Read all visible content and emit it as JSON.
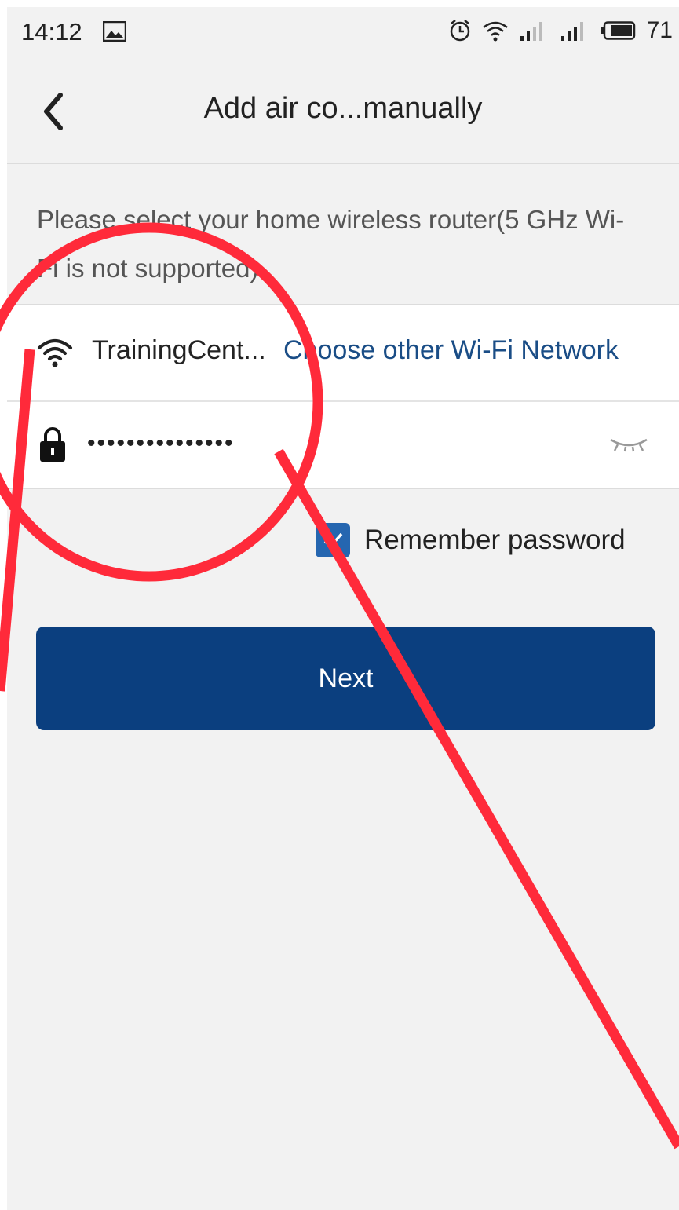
{
  "status_bar": {
    "time": "14:12",
    "battery_level": "71",
    "icons": [
      "image-icon",
      "alarm-icon",
      "wifi-status-icon",
      "signal-icon",
      "signal-icon",
      "battery-icon"
    ]
  },
  "header": {
    "title": "Add air co...manually",
    "back_icon": "chevron-left-icon"
  },
  "instruction": "Please select your home wireless router(5 GHz Wi-Fi is not supported)",
  "wifi_row": {
    "ssid": "TrainingCent...",
    "choose_link": "Choose other Wi-Fi Network",
    "icon": "wifi-icon"
  },
  "password_row": {
    "value": "•••••••••••••••",
    "icon": "lock-icon",
    "toggle_icon": "eye-closed-icon"
  },
  "remember": {
    "label": "Remember password",
    "checked": true
  },
  "next_button": {
    "label": "Next"
  },
  "colors": {
    "primary": "#0b3f7f",
    "link": "#1a4d86",
    "checkbox": "#2566b0",
    "background": "#f2f2f2",
    "annotation": "#ff2a3a"
  }
}
